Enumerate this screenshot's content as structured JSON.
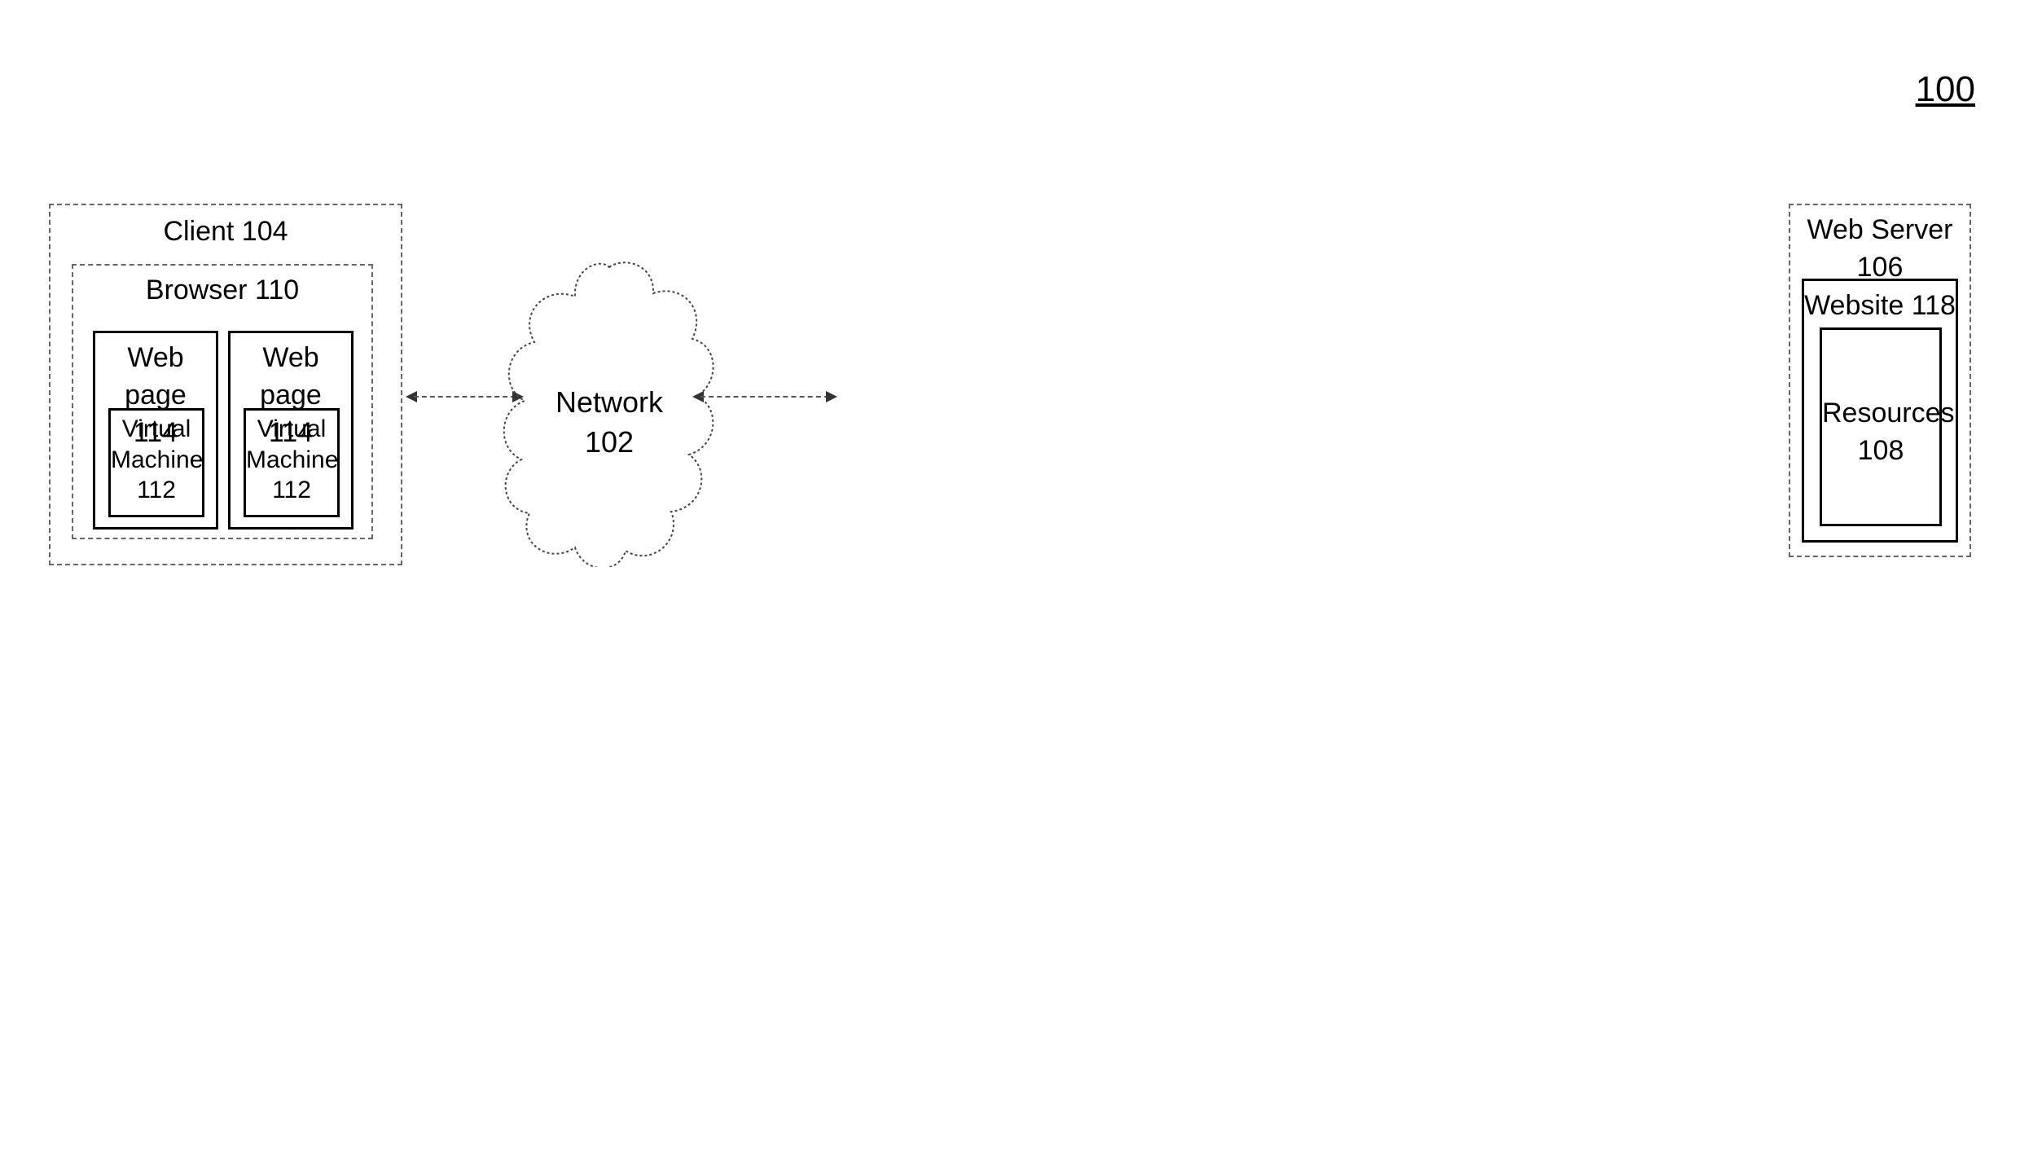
{
  "figure_number": "100",
  "client": {
    "label": "Client 104"
  },
  "browser": {
    "label": "Browser 110"
  },
  "webpage": {
    "label": "Web page\n114"
  },
  "vm": {
    "label": "Virtual\nMachine\n112"
  },
  "network": {
    "label": "Network\n102"
  },
  "server": {
    "label": "Web Server\n106"
  },
  "website": {
    "label": "Website 118"
  },
  "resources": {
    "label": "Resources\n108"
  }
}
